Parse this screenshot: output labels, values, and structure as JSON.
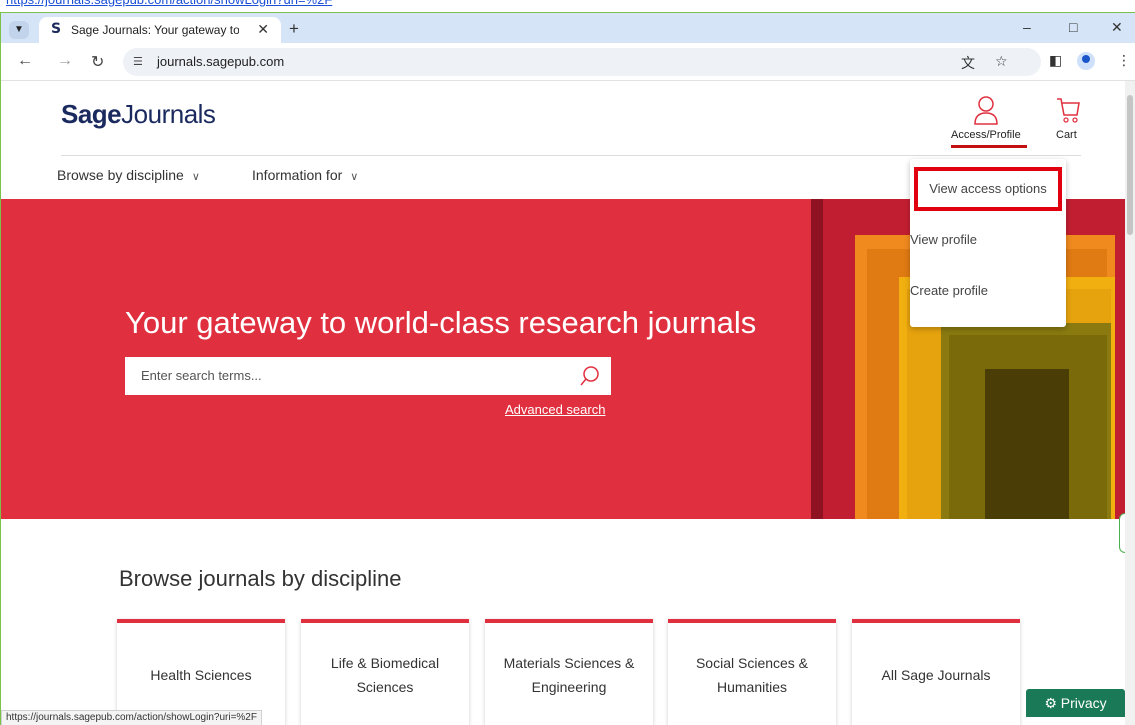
{
  "browser": {
    "tab_title": "Sage Journals: Your gateway to",
    "tab_favicon": "S",
    "url": "journals.sagepub.com",
    "status_url": "https://journals.sagepub.com/action/showLogin?uri=%2F"
  },
  "header": {
    "logo_bold": "Sage",
    "logo_rest": "Journals",
    "access_label": "Access/Profile",
    "cart_label": "Cart"
  },
  "nav": {
    "items": [
      {
        "label": "Browse by discipline"
      },
      {
        "label": "Information for"
      }
    ]
  },
  "dropdown": {
    "items": [
      {
        "label": "View access options"
      },
      {
        "label": "View profile"
      },
      {
        "label": "Create profile"
      }
    ]
  },
  "hero": {
    "title": "Your gateway to world-class research journals",
    "search_placeholder": "Enter search terms...",
    "advanced_search": "Advanced search"
  },
  "browse": {
    "title": "Browse journals by discipline",
    "cards": [
      {
        "label": "Health Sciences"
      },
      {
        "label": "Life & Biomedical Sciences"
      },
      {
        "label": "Materials Sciences & Engineering"
      },
      {
        "label": "Social Sciences & Humanities"
      },
      {
        "label": "All Sage Journals"
      }
    ]
  },
  "privacy": {
    "label": "Privacy"
  },
  "colors": {
    "accent_red": "#e0303f",
    "highlight_red": "#e1000f",
    "logo_navy": "#1a2a5e",
    "privacy_green": "#1a7a57"
  },
  "icons": [
    "user-icon",
    "cart-icon",
    "search-icon",
    "chevron-down-icon",
    "gear-icon",
    "star-icon",
    "translate-icon"
  ]
}
